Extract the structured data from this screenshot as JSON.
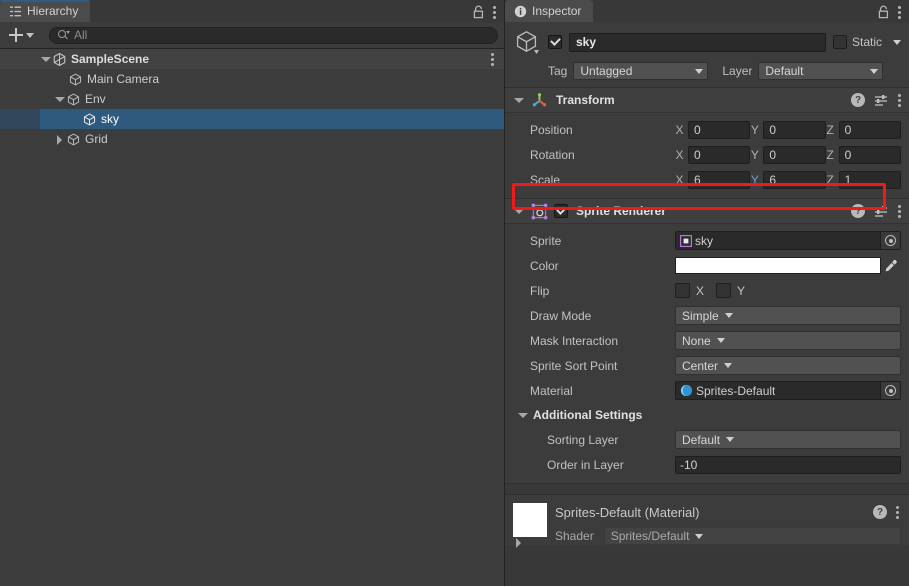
{
  "hierarchy": {
    "tab": {
      "label": "Hierarchy",
      "icon": "hierarchy-icon"
    },
    "toolbar": {
      "add_label": "+",
      "search_placeholder": "All",
      "search_value": ""
    },
    "rows": [
      {
        "label": "SampleScene",
        "icon": "unity-logo-icon",
        "indent": 0,
        "twisty": "open",
        "type": "scene",
        "selected": false
      },
      {
        "label": "Main Camera",
        "icon": "gameobject-cube-icon",
        "indent": 1,
        "twisty": "none",
        "type": "gameobject",
        "selected": false
      },
      {
        "label": "Env",
        "icon": "gameobject-cube-icon",
        "indent": 1,
        "twisty": "open",
        "type": "gameobject",
        "selected": false
      },
      {
        "label": "sky",
        "icon": "gameobject-cube-icon",
        "indent": 2,
        "twisty": "none",
        "type": "gameobject",
        "selected": true
      },
      {
        "label": "Grid",
        "icon": "gameobject-cube-icon",
        "indent": 1,
        "twisty": "closed",
        "type": "gameobject",
        "selected": false
      }
    ]
  },
  "inspector": {
    "tab": {
      "label": "Inspector",
      "icon": "info-icon"
    },
    "object_header": {
      "enabled": true,
      "name": "sky",
      "static_label": "Static",
      "static_checked": false,
      "tag_label": "Tag",
      "tag_value": "Untagged",
      "layer_label": "Layer",
      "layer_value": "Default"
    },
    "transform": {
      "title": "Transform",
      "position": {
        "label": "Position",
        "x": "0",
        "y": "0",
        "z": "0"
      },
      "rotation": {
        "label": "Rotation",
        "x": "0",
        "y": "0",
        "z": "0"
      },
      "scale": {
        "label": "Scale",
        "x": "6",
        "y": "6",
        "z": "1"
      },
      "axis_labels": {
        "x": "X",
        "y": "Y",
        "z": "Z"
      }
    },
    "sprite_renderer": {
      "title": "Sprite Renderer",
      "enabled": true,
      "sprite": {
        "label": "Sprite",
        "value": "sky"
      },
      "color": {
        "label": "Color",
        "value": "#ffffff"
      },
      "flip": {
        "label": "Flip",
        "x_label": "X",
        "y_label": "Y",
        "x": false,
        "y": false
      },
      "draw_mode": {
        "label": "Draw Mode",
        "value": "Simple"
      },
      "mask_interaction": {
        "label": "Mask Interaction",
        "value": "None"
      },
      "sprite_sort_point": {
        "label": "Sprite Sort Point",
        "value": "Center"
      },
      "material": {
        "label": "Material",
        "value": "Sprites-Default"
      },
      "additional_settings": {
        "label": "Additional Settings",
        "sorting_layer": {
          "label": "Sorting Layer",
          "value": "Default"
        },
        "order_in_layer": {
          "label": "Order in Layer",
          "value": "-10"
        }
      }
    },
    "material_preview": {
      "title": "Sprites-Default (Material)",
      "shader_label": "Shader",
      "shader_value": "Sprites/Default"
    }
  },
  "annotation": {
    "type": "red-rectangle-highlight",
    "target": "transform-scale-row",
    "color": "#ef1b1b"
  },
  "theme": {
    "accent_selection": "#2f5a80",
    "panel_bg": "#383838",
    "row_bg": "#3c3c3c",
    "field_bg": "#2a2a2a",
    "dropdown_bg": "#515151",
    "text": "#c4c4c4"
  }
}
